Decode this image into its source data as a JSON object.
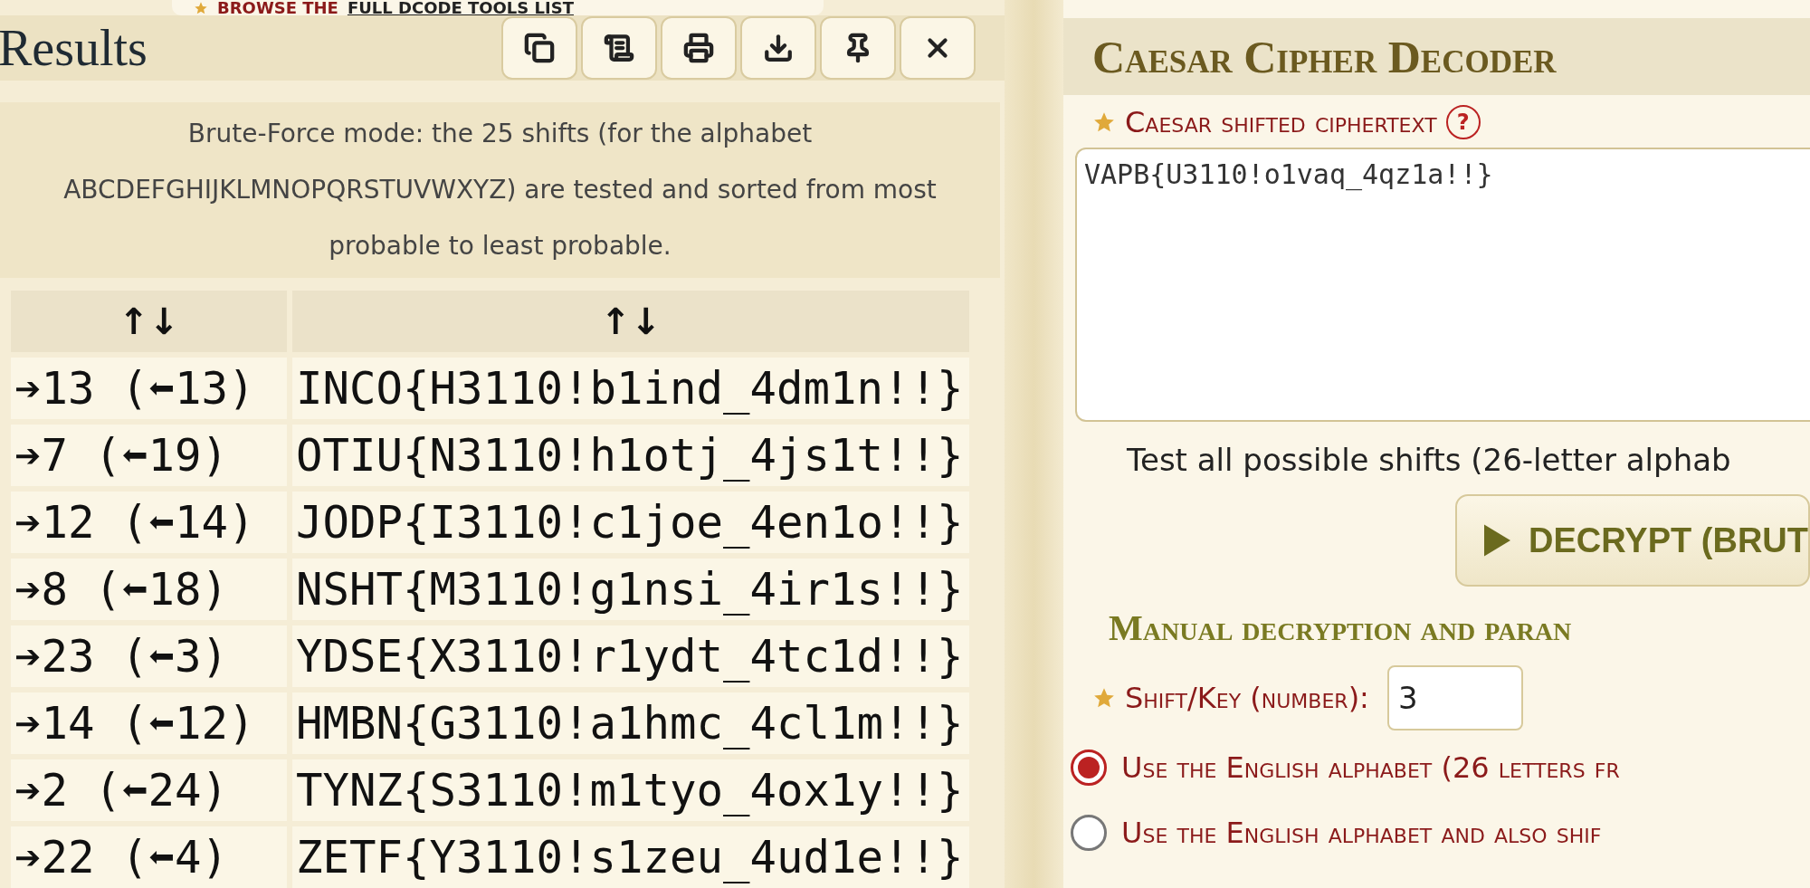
{
  "top_link": {
    "prefix": "BROWSE THE",
    "link": "FULL DCODE TOOLS LIST"
  },
  "results": {
    "title": "Results",
    "toolbar": [
      {
        "kind": "copy"
      },
      {
        "kind": "scroll"
      },
      {
        "kind": "print"
      },
      {
        "kind": "download"
      },
      {
        "kind": "pin"
      },
      {
        "kind": "close"
      }
    ],
    "description": "Brute-Force mode: the 25 shifts (for the alphabet ABCDEFGHIJKLMNOPQRSTUVWXYZ) are tested and sorted from most probable to least probable.",
    "table": {
      "columns": [
        "↑↓",
        "↑↓"
      ],
      "rows": [
        [
          "➔13 (⬅13)",
          "INCO{H3110!b1ind_4dm1n!!}"
        ],
        [
          "➔7 (⬅19)",
          "OTIU{N3110!h1otj_4js1t!!}"
        ],
        [
          "➔12 (⬅14)",
          "JODP{I3110!c1joe_4en1o!!}"
        ],
        [
          "➔8 (⬅18)",
          "NSHT{M3110!g1nsi_4ir1s!!}"
        ],
        [
          "➔23 (⬅3)",
          "YDSE{X3110!r1ydt_4tc1d!!}"
        ],
        [
          "➔14 (⬅12)",
          "HMBN{G3110!a1hmc_4cl1m!!}"
        ],
        [
          "➔2 (⬅24)",
          "TYNZ{S3110!m1tyo_4ox1y!!}"
        ],
        [
          "➔22 (⬅4)",
          "ZETF{Y3110!s1zeu_4ud1e!!}"
        ]
      ]
    }
  },
  "decoder": {
    "title": "Caesar Cipher Decoder",
    "ciphertext_label": "Caesar shifted ciphertext",
    "help": "?",
    "ciphertext": "VAPB{U3110!o1vaq_4qz1a!!}",
    "brute_note": "Test all possible shifts (26-letter alphab",
    "decrypt_button": "DECRYPT (BRUT",
    "manual_heading": "Manual decryption and paran",
    "shift_label": "Shift/Key (number):",
    "shift_value": "3",
    "options": [
      {
        "label": "Use the English alphabet (26 letters fr",
        "selected": true
      },
      {
        "label": "Use the English alphabet and also shif",
        "selected": false
      }
    ]
  }
}
